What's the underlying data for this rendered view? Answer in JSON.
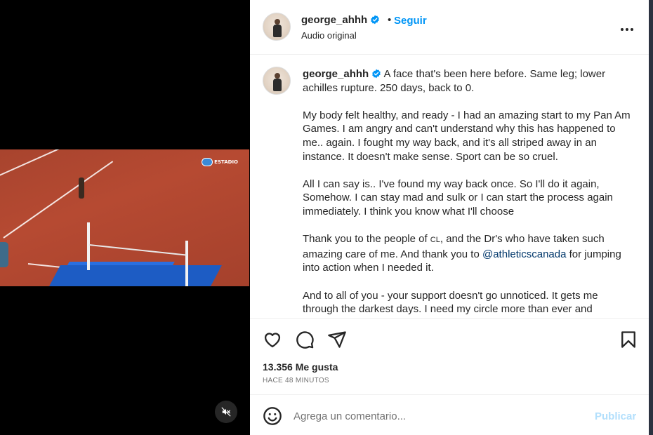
{
  "post": {
    "username": "george_ahhh",
    "follow_label": "Seguir",
    "separator": "•",
    "audio_label": "Audio original",
    "more_icon": "more-horizontal-icon"
  },
  "caption": {
    "username": "george_ahhh",
    "p1": "A face that's been here before. Same leg; lower achilles rupture. 250 days, back to 0.",
    "p2": "My body felt healthy, and ready - I had an amazing start to my Pan Am Games. I am angry and can't understand why this has happened to me.. again. I fought my way back, and it's all striped away in an instance. It doesn't make sense. Sport can be so cruel.",
    "p3": "All I can say is.. I've found my way back once. So I'll do it again, Somehow. I can stay mad and sulk or I can start the process again immediately. I think you know what I'll choose",
    "p4_before": "Thank you to the people of ",
    "p4_flag": "CL",
    "p4_middle": ", and the Dr's who have taken such amazing care of me. And thank you to ",
    "p4_mention": "@athleticscanada",
    "p4_after": " for jumping into action when I needed it.",
    "p5": "And to all of you - your support doesn't go unnoticed. It gets me through the darkest days. I need my circle more than ever and"
  },
  "actions": {
    "likes": "13.356 Me gusta",
    "time_ago": "HACE 48 MINUTOS"
  },
  "comment": {
    "placeholder": "Agrega un comentario...",
    "publish_label": "Publicar"
  },
  "video": {
    "broadcast_logo": "ESTADIO",
    "muted": true
  },
  "colors": {
    "accent": "#0095f6",
    "verified": "#0095f6",
    "publish_disabled": "#b2dffc",
    "mention": "#00376b"
  }
}
